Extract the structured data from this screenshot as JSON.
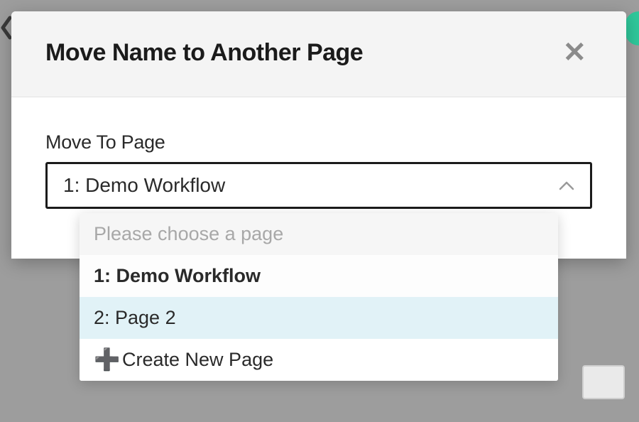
{
  "modal": {
    "title": "Move Name to Another Page",
    "field_label": "Move To Page",
    "selected_value": "1: Demo Workflow"
  },
  "dropdown": {
    "placeholder": "Please choose a page",
    "options": [
      {
        "label": "1: Demo Workflow",
        "selected": true
      },
      {
        "label": "2: Page 2",
        "hovered": true
      }
    ],
    "create_label": "Create New Page"
  }
}
